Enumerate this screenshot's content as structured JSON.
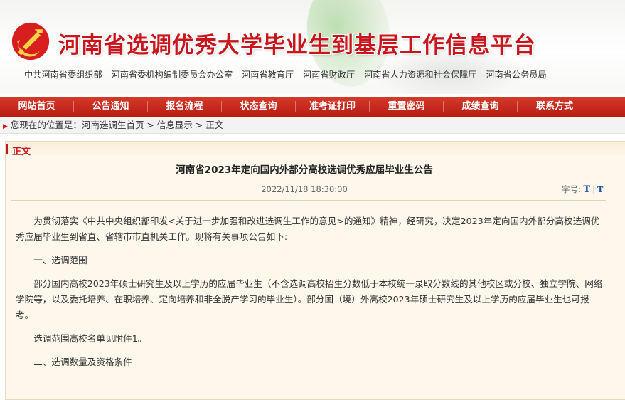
{
  "header": {
    "site_title": "河南省选调优秀大学毕业生到基层工作信息平台",
    "orgs": [
      "中共河南省委组织部",
      "河南省委机构编制委员会办公室",
      "河南省教育厅",
      "河南省财政厅",
      "河南省人力资源和社会保障厅",
      "河南省公务员局"
    ],
    "logo_icon": "party-emblem-icon"
  },
  "nav": {
    "items": [
      "网站首页",
      "公告通知",
      "报名流程",
      "状态查询",
      "准考证打印",
      "重置密码",
      "成绩查询",
      "联系方式"
    ]
  },
  "breadcrumb": {
    "prefix": "您现在的位置是：",
    "home": "河南选调生首页",
    "sep": " > ",
    "section": "信息显示",
    "current": "正文"
  },
  "panel": {
    "tag": "正文",
    "title": "河南省2023年定向国内外部分高校选调优秀应届毕业生公告",
    "date": "2022/11/18 18:30:00",
    "fontsize_label": "字号:",
    "fontsize_large": "T",
    "fontsize_sep": "|",
    "fontsize_small": "T",
    "paragraphs": [
      "为贯彻落实《中共中央组织部印发<关于进一步加强和改进选调生工作的意见>的通知》精神，经研究，决定2023年定向国内外部分高校选调优秀应届毕业生到省直、省辖市市直机关工作。现将有关事项公告如下:",
      "一、选调范围",
      "部分国内高校2023年硕士研究生及以上学历的应届毕业生（不含选调高校招生分数低于本校统一录取分数线的其他校区或分校、独立学院、网络学院等，以及委托培养、在职培养、定向培养和非全脱产学习的毕业生）。部分国（境）外高校2023年硕士研究生及以上学历的应届毕业生也可报考。",
      "选调范围高校名单见附件1。",
      "二、选调数量及资格条件"
    ]
  },
  "colors": {
    "brand_red": "#c8161d",
    "nav_red": "#c4261a",
    "panel_bg": "#fdf7ec",
    "fontsize_blue": "#1b4f9c"
  }
}
